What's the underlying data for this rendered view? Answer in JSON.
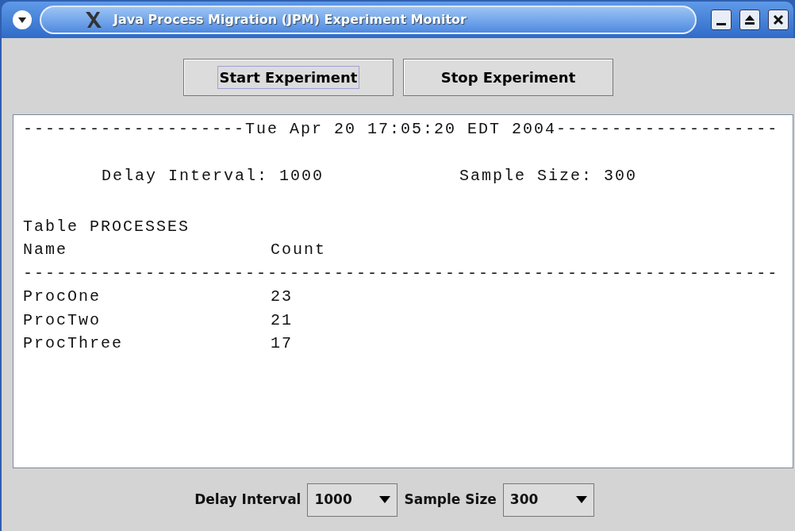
{
  "window": {
    "title": "Java Process Migration (JPM) Experiment Monitor"
  },
  "buttons": [
    {
      "label": "Start Experiment",
      "focused": true
    },
    {
      "label": "Stop Experiment",
      "focused": false
    }
  ],
  "output": {
    "header": "--------------------Tue Apr 20 17:05:20 EDT 2004--------------------",
    "delay_interval": "Delay Interval: 1000",
    "sample_size": "Sample Size: 300",
    "table_title": "Table PROCESSES",
    "columns": [
      "Name",
      "Count"
    ],
    "separator": "--------------------------------------------------------------------",
    "rows": [
      [
        "ProcOne",
        "23"
      ],
      [
        "ProcTwo",
        "21"
      ],
      [
        "ProcThree",
        "17"
      ]
    ]
  },
  "controls": [
    {
      "label": "Delay Interval",
      "value": "1000"
    },
    {
      "label": "Sample Size",
      "value": "300"
    }
  ]
}
